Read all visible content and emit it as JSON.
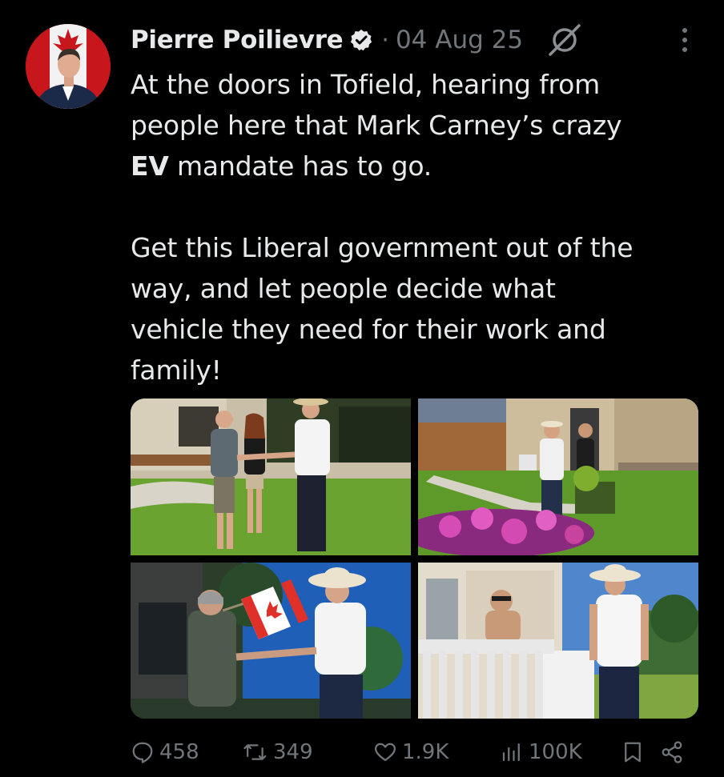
{
  "author": {
    "name": "Pierre Poilievre",
    "separator": "·",
    "date": "04 Aug 25",
    "verified_icon": "verified-badge-icon"
  },
  "tweet": {
    "line1": "At the doors in Tofield, hearing from",
    "line2": "people here that Mark Carney’s crazy",
    "line3_bold": "EV",
    "line3_rest": " mandate has to go.",
    "line4": "Get this Liberal government out of the",
    "line5": "way, and let people decide what",
    "line6": "vehicle they need for their work and",
    "line7": "family!"
  },
  "media": {
    "photos": [
      "photo-handshake-lawn",
      "photo-doorstep-visit",
      "photo-canada-flag-handshake",
      "photo-fence-conversation"
    ]
  },
  "actions": {
    "replies": "458",
    "reposts": "349",
    "likes": "1.9K",
    "views": "100K"
  },
  "colors": {
    "background": "#000000",
    "text": "#e7e9ea",
    "muted": "#71767b",
    "verified": "#1d9bf0"
  }
}
